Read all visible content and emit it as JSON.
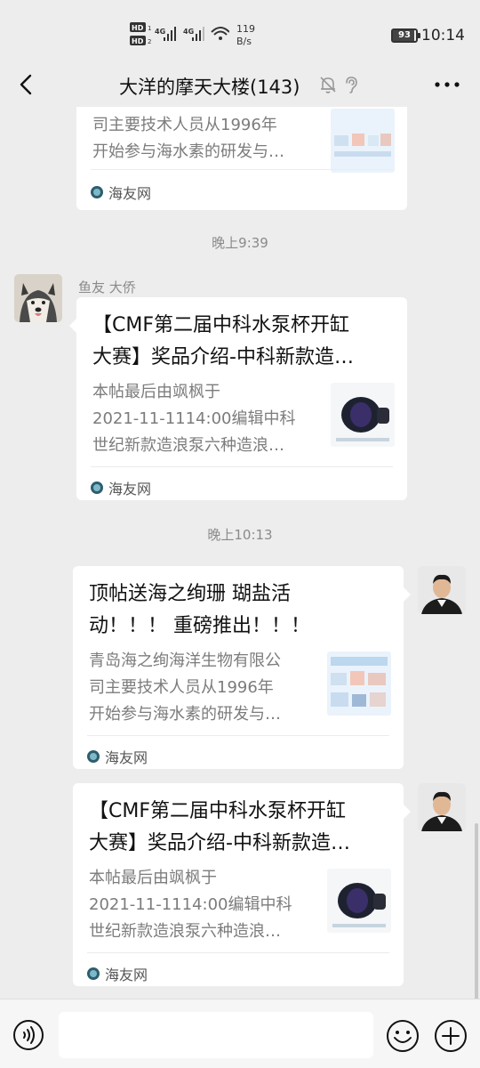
{
  "status": {
    "sig1": "HD 4G",
    "sig2": "HD 4G",
    "net_speed_value": "119",
    "net_speed_unit": "B/s",
    "battery": "93",
    "time": "10:14"
  },
  "header": {
    "title": "大洋的摩天大楼(143)",
    "back_icon": "chevron-left-icon",
    "mute_icon": "bell-off-icon",
    "ear_icon": "ear-icon",
    "more_icon": "more-horizontal-icon"
  },
  "messages": [
    {
      "desc_line1": "司主要技术人员从1996年",
      "desc_line2": "开始参与海水素的研发与…",
      "source": "海友网"
    },
    {
      "timestamp": "晚上9:39",
      "sender": "鱼友 大侨",
      "title_line1": "【CMF第二届中科水泵杯开缸",
      "title_line2": "大赛】奖品介绍-中科新款造…",
      "desc_line1": "本帖最后由飒枫于",
      "desc_line2": "2021-11-1114:00编辑中科",
      "desc_line3": "世纪新款造浪泵六种造浪…",
      "source": "海友网"
    },
    {
      "timestamp": "晚上10:13",
      "title_line1": "顶帖送海之绚珊 瑚盐活",
      "title_line2": "动！！！ 重磅推出！！！",
      "desc_line1": "青岛海之绚海洋生物有限公",
      "desc_line2": "司主要技术人员从1996年",
      "desc_line3": "开始参与海水素的研发与…",
      "source": "海友网"
    },
    {
      "title_line1": "【CMF第二届中科水泵杯开缸",
      "title_line2": "大赛】奖品介绍-中科新款造…",
      "desc_line1": "本帖最后由飒枫于",
      "desc_line2": "2021-11-1114:00编辑中科",
      "desc_line3": "世纪新款造浪泵六种造浪…",
      "source": "海友网"
    }
  ],
  "input": {
    "placeholder": "",
    "voice_icon": "voice-icon",
    "emoji_icon": "emoji-icon",
    "plus_icon": "plus-circle-icon"
  },
  "colors": {
    "background": "#ededed",
    "bubble": "#ffffff",
    "muted_text": "#7c7c7c"
  }
}
